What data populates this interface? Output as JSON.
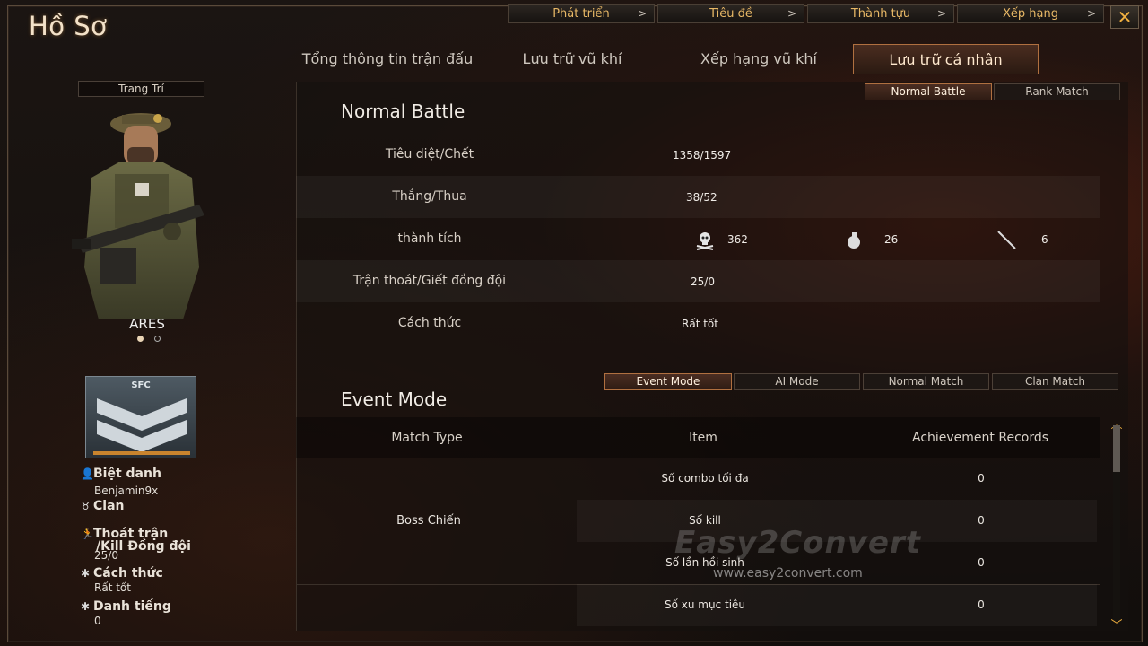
{
  "window": {
    "title": "Hồ Sơ"
  },
  "top_nav": [
    {
      "label": "Phát triển"
    },
    {
      "label": "Tiêu đề"
    },
    {
      "label": "Thành tựu"
    },
    {
      "label": "Xếp hạng"
    }
  ],
  "tabs": [
    {
      "label": "Tổng thông tin trận đấu"
    },
    {
      "label": "Lưu trữ vũ khí"
    },
    {
      "label": "Xếp hạng vũ khí"
    },
    {
      "label": "Lưu trữ cá nhân",
      "active": true
    }
  ],
  "left_panel": {
    "decoration_label": "Trang Trí",
    "character_name": "ARES",
    "rank_badge_text": "SFC",
    "nickname_label": "Biệt danh",
    "nickname_value": "Benjamin9x",
    "clan_label": "Clan",
    "escape_label_1": "Thoát trận",
    "escape_label_2": "/Kill Đồng đội",
    "escape_value": "25/0",
    "manner_label": "Cách thức",
    "manner_value": "Rất tốt",
    "reputation_label": "Danh tiếng",
    "reputation_value": "0"
  },
  "battle_mode_buttons": [
    {
      "label": "Normal Battle",
      "active": true
    },
    {
      "label": "Rank Match"
    }
  ],
  "normal_battle": {
    "title": "Normal Battle",
    "rows": [
      {
        "label": "Tiêu diệt/Chết",
        "value": "1358/1597"
      },
      {
        "label": "Thắng/Thua",
        "value": "38/52"
      },
      {
        "label": "thành tích"
      },
      {
        "label": "Trận thoát/Giết đồng đội",
        "value": "25/0"
      },
      {
        "label": "Cách thức",
        "value": "Rất tốt"
      }
    ],
    "achievements": [
      {
        "icon": "skull-icon",
        "value": "362"
      },
      {
        "icon": "grenade-icon",
        "value": "26"
      },
      {
        "icon": "knife-icon",
        "value": "6"
      }
    ]
  },
  "event_mode": {
    "title": "Event Mode",
    "buttons": [
      {
        "label": "Event Mode",
        "active": true
      },
      {
        "label": "AI Mode"
      },
      {
        "label": "Normal Match"
      },
      {
        "label": "Clan Match"
      }
    ],
    "columns": [
      "Match Type",
      "Item",
      "Achievement Records"
    ],
    "match_type": "Boss Chiến",
    "rows": [
      {
        "item": "Số combo tối đa",
        "record": "0"
      },
      {
        "item": "Số kill",
        "record": "0"
      },
      {
        "item": "Số lần hồi sinh",
        "record": "0"
      },
      {
        "item": "Số xu mục tiêu",
        "record": "0"
      }
    ]
  },
  "watermark": {
    "brand": "Easy2Convert",
    "url": "www.easy2convert.com"
  },
  "colors": {
    "accent": "#e8b866",
    "active_border": "#b07040",
    "close_x": "#f0b040"
  }
}
